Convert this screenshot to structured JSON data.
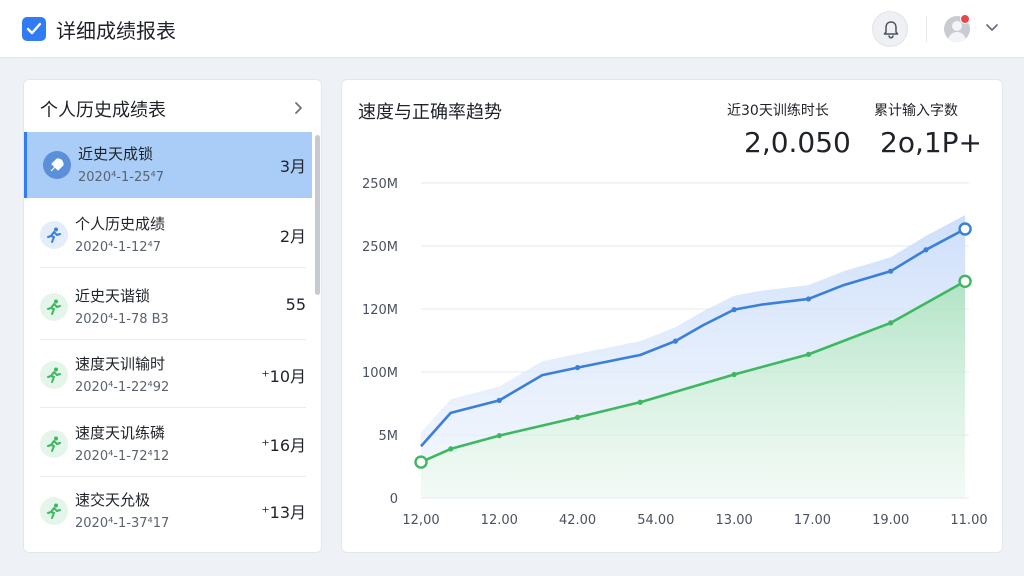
{
  "app": {
    "title": "详细成绩报表",
    "icon": "check-icon",
    "brand_color": "#2f7cf6"
  },
  "header": {
    "bell_icon": "bell-icon",
    "avatar_icon": "avatar-icon",
    "menu_icon": "chevron-down-icon",
    "badge_color": "#e5484d"
  },
  "history": {
    "title": "个人历史成绩表",
    "items": [
      {
        "title": "近史天成锁",
        "date": "2020⁴-1-25⁴7",
        "value": "3月",
        "icon": "rocket-icon",
        "active": true
      },
      {
        "title": "个人历史成绩",
        "date": "2020⁴-1-12⁴7",
        "value": "2月",
        "icon": "runner-icon",
        "active": false
      },
      {
        "title": "近史天谐锁",
        "date": "2020⁴-1-78 B3",
        "value": "55",
        "icon": "runner-icon",
        "active": false
      },
      {
        "title": "速度天训输时",
        "date": "2020⁴-1-22⁴92",
        "value": "⁺10月",
        "icon": "runner-icon",
        "active": false
      },
      {
        "title": "速度天讥练磷",
        "date": "2020⁴-1-72⁴12",
        "value": "⁺16月",
        "icon": "runner-icon",
        "active": false
      },
      {
        "title": "速交天允极",
        "date": "2020⁴-1-37⁴17",
        "value": "⁺13月",
        "icon": "runner-icon",
        "active": false
      }
    ]
  },
  "trend": {
    "title": "速度与正确率趋势",
    "stat1": {
      "label": "近30天训练时长",
      "value": "2,0.050"
    },
    "stat2": {
      "label": "累计输入字数",
      "value": "2o,1P+"
    }
  },
  "chart_data": {
    "type": "area",
    "x_labels": [
      "12,00",
      "12.00",
      "42.00",
      "54.00",
      "13.00",
      "17.00",
      "19.00",
      "11.00"
    ],
    "y_tick_labels": [
      "0",
      "5M",
      "100M",
      "120M",
      "250M",
      "250M"
    ],
    "y_tick_values": [
      0,
      1,
      2,
      3,
      4,
      5
    ],
    "ylim": [
      0,
      5
    ],
    "grid": true,
    "series": [
      {
        "color": "#3a7fd8",
        "fill": "#d4e4fb",
        "points": [
          [
            0.0,
            0.82
          ],
          [
            0.38,
            1.35
          ],
          [
            1.0,
            1.55
          ],
          [
            1.55,
            1.95
          ],
          [
            2.0,
            2.07
          ],
          [
            2.8,
            2.27
          ],
          [
            3.25,
            2.49
          ],
          [
            3.6,
            2.74
          ],
          [
            4.0,
            2.99
          ],
          [
            4.35,
            3.07
          ],
          [
            4.95,
            3.16
          ],
          [
            5.4,
            3.38
          ],
          [
            6.0,
            3.6
          ],
          [
            6.45,
            3.94
          ],
          [
            6.95,
            4.27
          ]
        ]
      },
      {
        "color": "#3db860",
        "fill": "#cfeedd",
        "points": [
          [
            0.0,
            0.57
          ],
          [
            0.38,
            0.78
          ],
          [
            1.0,
            0.99
          ],
          [
            2.0,
            1.28
          ],
          [
            2.8,
            1.52
          ],
          [
            4.0,
            1.96
          ],
          [
            4.95,
            2.28
          ],
          [
            6.0,
            2.78
          ],
          [
            6.95,
            3.44
          ]
        ]
      }
    ]
  }
}
